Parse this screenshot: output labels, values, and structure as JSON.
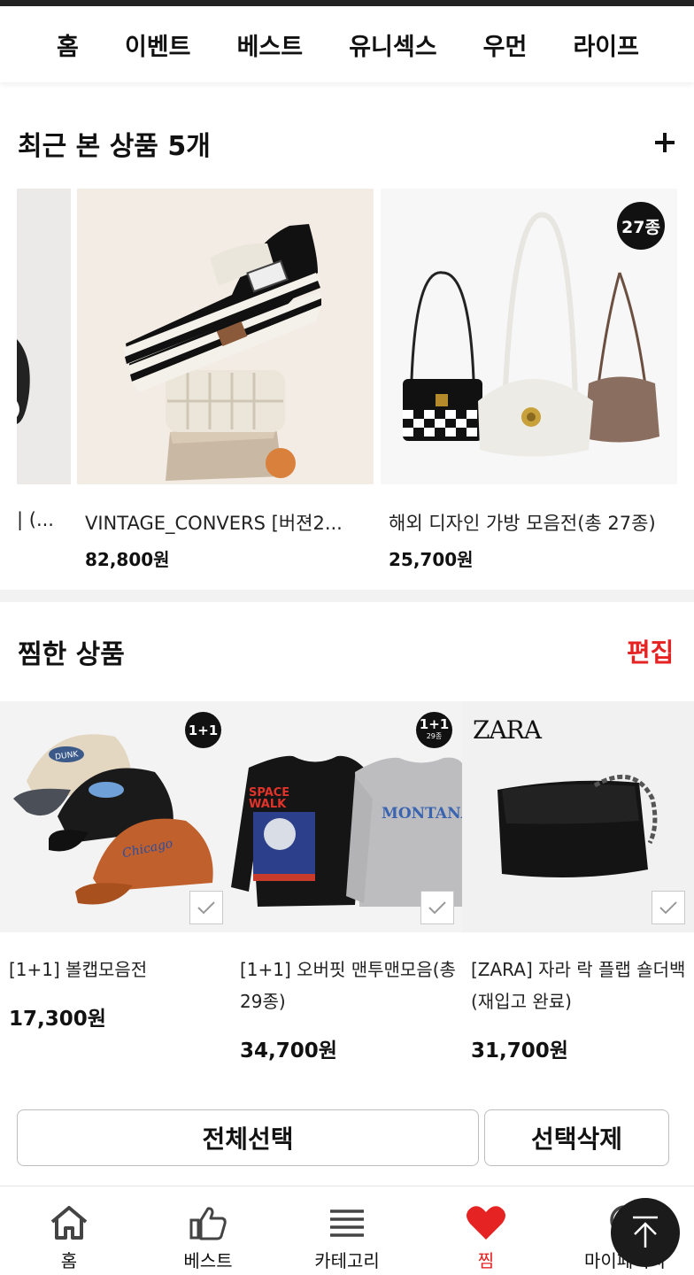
{
  "topnav": {
    "items": [
      "홈",
      "이벤트",
      "베스트",
      "유니섹스",
      "우먼",
      "라이프"
    ]
  },
  "recent": {
    "title": "최근 본 상품 5개",
    "items": [
      {
        "name": "| (...",
        "price": ""
      },
      {
        "name": "VINTAGE_CONVERS [버젼2...",
        "price": "82,800원"
      },
      {
        "name": "해외 디자인 가방 모음전(총 27종)",
        "price": "25,700원",
        "badge": "27종"
      }
    ]
  },
  "wishlist": {
    "title": "찜한 상품",
    "edit_label": "편집",
    "items": [
      {
        "name": "[1+1] 볼캡모음전",
        "price": "17,300원",
        "badge": "1+1"
      },
      {
        "name": "[1+1] 오버핏 맨투맨모음(총 29종)",
        "price": "34,700원",
        "badge": "1+1",
        "badge_sub": "29종"
      },
      {
        "name": "[ZARA] 자라 락 플랩 숄더백 (재입고 완료)",
        "price": "31,700원",
        "brand": "ZARA"
      }
    ],
    "product_art": {
      "cap_texts": [
        "DUNK",
        "Chicago"
      ],
      "sweatshirt_texts": [
        "SPACE",
        "WALK",
        "MONTANA"
      ]
    }
  },
  "actions": {
    "select_all": "전체선택",
    "delete_selected": "선택삭제"
  },
  "bottom_nav": {
    "items": [
      {
        "label": "홈",
        "icon": "home-icon"
      },
      {
        "label": "베스트",
        "icon": "thumbs-up-icon"
      },
      {
        "label": "카테고리",
        "icon": "menu-icon"
      },
      {
        "label": "찜",
        "icon": "heart-icon",
        "active": true
      },
      {
        "label": "마이페이지",
        "icon": "user-icon"
      }
    ]
  },
  "colors": {
    "accent": "#e62323",
    "text": "#111111",
    "divider": "#f2f2f2"
  }
}
